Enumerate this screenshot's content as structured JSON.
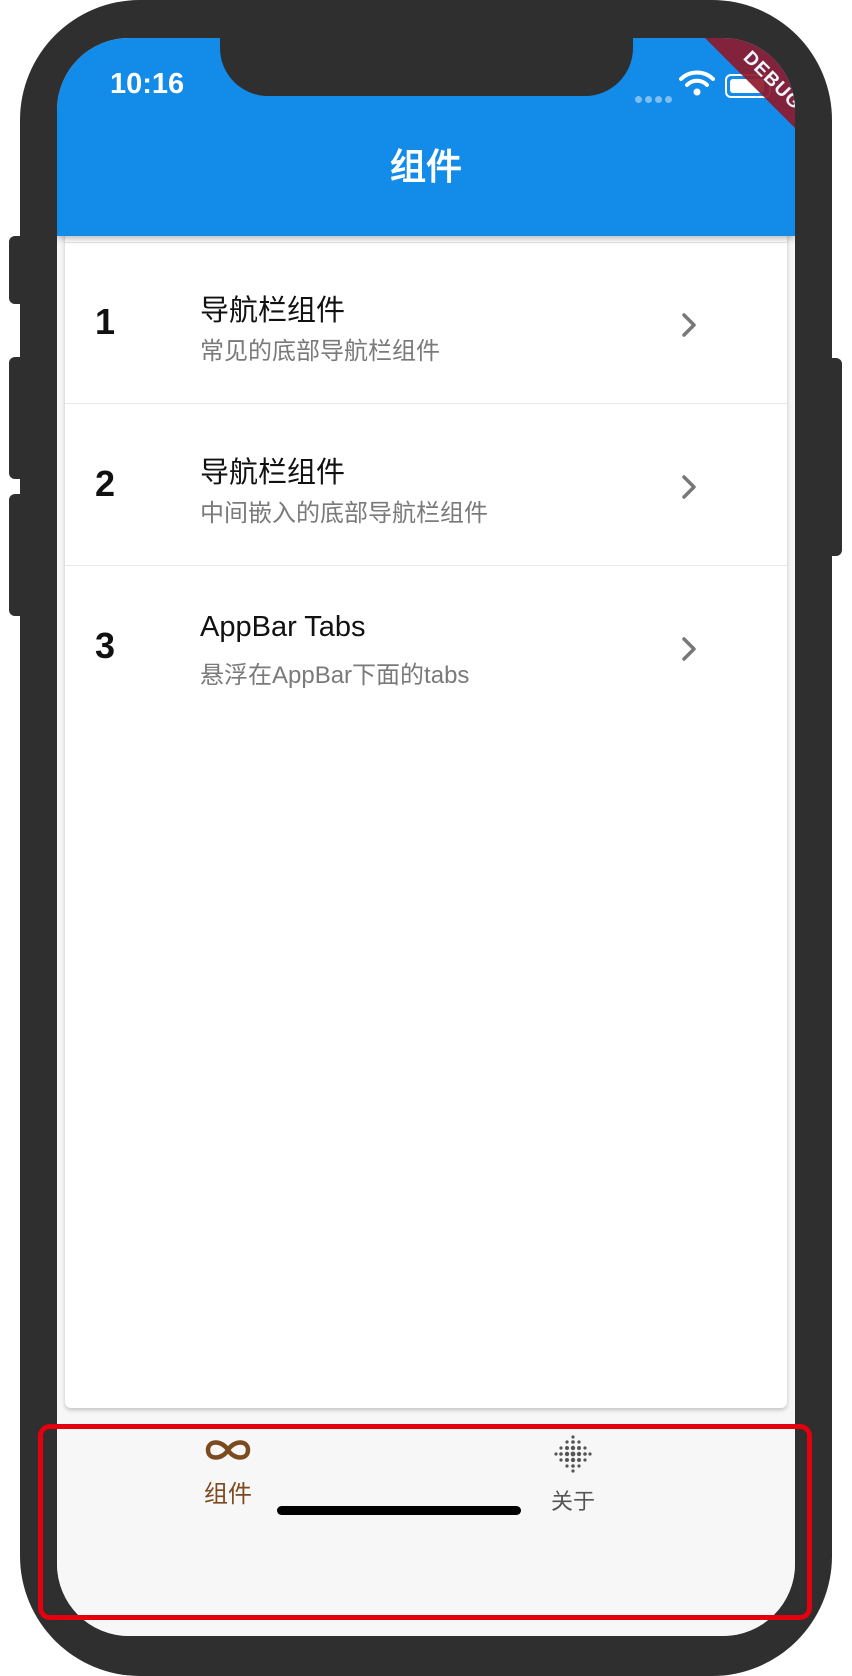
{
  "status_bar": {
    "time": "10:16"
  },
  "debug_banner": "DEBUG",
  "app_bar": {
    "title": "组件"
  },
  "list": {
    "items": [
      {
        "index": "1",
        "title": "导航栏组件",
        "subtitle": "常见的底部导航栏组件"
      },
      {
        "index": "2",
        "title": "导航栏组件",
        "subtitle": "中间嵌入的底部导航栏组件"
      },
      {
        "index": "3",
        "title": "AppBar Tabs",
        "subtitle": "悬浮在AppBar下面的tabs"
      }
    ]
  },
  "bottom_nav": {
    "items": [
      {
        "label": "组件",
        "icon": "infinity-icon",
        "active": true
      },
      {
        "label": "关于",
        "icon": "dots-grid-icon",
        "active": false
      }
    ]
  },
  "colors": {
    "app_bar": "#138be9",
    "active_tab": "#7b4a1f",
    "inactive_tab": "#555555",
    "highlight": "#e3000f",
    "debug_banner": "#8e1b2c"
  }
}
